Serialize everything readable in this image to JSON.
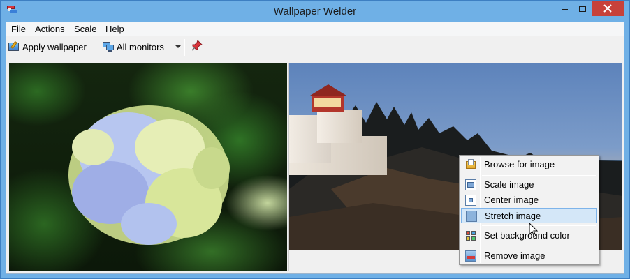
{
  "window": {
    "title": "Wallpaper Welder"
  },
  "menubar": {
    "items": [
      "File",
      "Actions",
      "Scale",
      "Help"
    ]
  },
  "toolbar": {
    "apply_label": "Apply wallpaper",
    "monitors_label": "All monitors"
  },
  "context_menu": {
    "items": [
      {
        "label": "Browse for image",
        "icon": "folder-icon"
      },
      {
        "label": "Scale image",
        "icon": "scale-image-icon"
      },
      {
        "label": "Center image",
        "icon": "center-image-icon"
      },
      {
        "label": "Stretch image",
        "icon": "stretch-image-icon",
        "selected": true
      },
      {
        "label": "Set background color",
        "icon": "color-palette-icon"
      },
      {
        "label": "Remove image",
        "icon": "remove-image-icon"
      }
    ]
  },
  "colors": {
    "titlebar": "#6fb0e6",
    "close_button": "#c7413a",
    "menu_highlight": "#d4e7f8"
  }
}
